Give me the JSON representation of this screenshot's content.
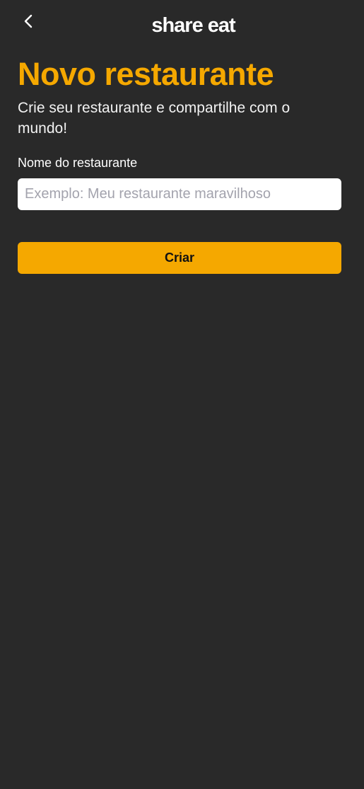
{
  "theme": {
    "accent": "#F5A800",
    "background": "#292929",
    "text": "#FFFFFF"
  },
  "header": {
    "back_icon": "chevron-left-icon",
    "app_name": "share eat"
  },
  "main": {
    "title": "Novo restaurante",
    "subtitle": "Crie seu restaurante e compartilhe com o mundo!",
    "form": {
      "name_label": "Nome do restaurante",
      "name_value": "",
      "name_placeholder": "Exemplo: Meu restaurante maravilhoso",
      "submit_label": "Criar"
    }
  }
}
